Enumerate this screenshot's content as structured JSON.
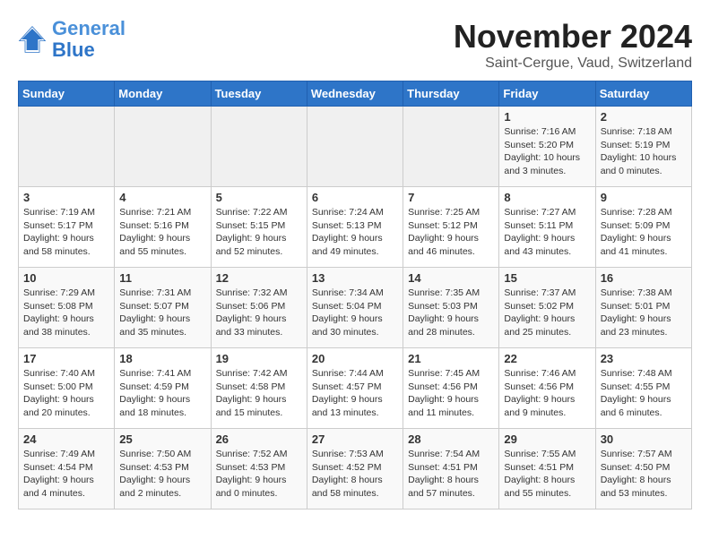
{
  "header": {
    "logo_line1": "General",
    "logo_line2": "Blue",
    "month": "November 2024",
    "location": "Saint-Cergue, Vaud, Switzerland"
  },
  "weekdays": [
    "Sunday",
    "Monday",
    "Tuesday",
    "Wednesday",
    "Thursday",
    "Friday",
    "Saturday"
  ],
  "weeks": [
    [
      {
        "day": "",
        "info": ""
      },
      {
        "day": "",
        "info": ""
      },
      {
        "day": "",
        "info": ""
      },
      {
        "day": "",
        "info": ""
      },
      {
        "day": "",
        "info": ""
      },
      {
        "day": "1",
        "info": "Sunrise: 7:16 AM\nSunset: 5:20 PM\nDaylight: 10 hours\nand 3 minutes."
      },
      {
        "day": "2",
        "info": "Sunrise: 7:18 AM\nSunset: 5:19 PM\nDaylight: 10 hours\nand 0 minutes."
      }
    ],
    [
      {
        "day": "3",
        "info": "Sunrise: 7:19 AM\nSunset: 5:17 PM\nDaylight: 9 hours\nand 58 minutes."
      },
      {
        "day": "4",
        "info": "Sunrise: 7:21 AM\nSunset: 5:16 PM\nDaylight: 9 hours\nand 55 minutes."
      },
      {
        "day": "5",
        "info": "Sunrise: 7:22 AM\nSunset: 5:15 PM\nDaylight: 9 hours\nand 52 minutes."
      },
      {
        "day": "6",
        "info": "Sunrise: 7:24 AM\nSunset: 5:13 PM\nDaylight: 9 hours\nand 49 minutes."
      },
      {
        "day": "7",
        "info": "Sunrise: 7:25 AM\nSunset: 5:12 PM\nDaylight: 9 hours\nand 46 minutes."
      },
      {
        "day": "8",
        "info": "Sunrise: 7:27 AM\nSunset: 5:11 PM\nDaylight: 9 hours\nand 43 minutes."
      },
      {
        "day": "9",
        "info": "Sunrise: 7:28 AM\nSunset: 5:09 PM\nDaylight: 9 hours\nand 41 minutes."
      }
    ],
    [
      {
        "day": "10",
        "info": "Sunrise: 7:29 AM\nSunset: 5:08 PM\nDaylight: 9 hours\nand 38 minutes."
      },
      {
        "day": "11",
        "info": "Sunrise: 7:31 AM\nSunset: 5:07 PM\nDaylight: 9 hours\nand 35 minutes."
      },
      {
        "day": "12",
        "info": "Sunrise: 7:32 AM\nSunset: 5:06 PM\nDaylight: 9 hours\nand 33 minutes."
      },
      {
        "day": "13",
        "info": "Sunrise: 7:34 AM\nSunset: 5:04 PM\nDaylight: 9 hours\nand 30 minutes."
      },
      {
        "day": "14",
        "info": "Sunrise: 7:35 AM\nSunset: 5:03 PM\nDaylight: 9 hours\nand 28 minutes."
      },
      {
        "day": "15",
        "info": "Sunrise: 7:37 AM\nSunset: 5:02 PM\nDaylight: 9 hours\nand 25 minutes."
      },
      {
        "day": "16",
        "info": "Sunrise: 7:38 AM\nSunset: 5:01 PM\nDaylight: 9 hours\nand 23 minutes."
      }
    ],
    [
      {
        "day": "17",
        "info": "Sunrise: 7:40 AM\nSunset: 5:00 PM\nDaylight: 9 hours\nand 20 minutes."
      },
      {
        "day": "18",
        "info": "Sunrise: 7:41 AM\nSunset: 4:59 PM\nDaylight: 9 hours\nand 18 minutes."
      },
      {
        "day": "19",
        "info": "Sunrise: 7:42 AM\nSunset: 4:58 PM\nDaylight: 9 hours\nand 15 minutes."
      },
      {
        "day": "20",
        "info": "Sunrise: 7:44 AM\nSunset: 4:57 PM\nDaylight: 9 hours\nand 13 minutes."
      },
      {
        "day": "21",
        "info": "Sunrise: 7:45 AM\nSunset: 4:56 PM\nDaylight: 9 hours\nand 11 minutes."
      },
      {
        "day": "22",
        "info": "Sunrise: 7:46 AM\nSunset: 4:56 PM\nDaylight: 9 hours\nand 9 minutes."
      },
      {
        "day": "23",
        "info": "Sunrise: 7:48 AM\nSunset: 4:55 PM\nDaylight: 9 hours\nand 6 minutes."
      }
    ],
    [
      {
        "day": "24",
        "info": "Sunrise: 7:49 AM\nSunset: 4:54 PM\nDaylight: 9 hours\nand 4 minutes."
      },
      {
        "day": "25",
        "info": "Sunrise: 7:50 AM\nSunset: 4:53 PM\nDaylight: 9 hours\nand 2 minutes."
      },
      {
        "day": "26",
        "info": "Sunrise: 7:52 AM\nSunset: 4:53 PM\nDaylight: 9 hours\nand 0 minutes."
      },
      {
        "day": "27",
        "info": "Sunrise: 7:53 AM\nSunset: 4:52 PM\nDaylight: 8 hours\nand 58 minutes."
      },
      {
        "day": "28",
        "info": "Sunrise: 7:54 AM\nSunset: 4:51 PM\nDaylight: 8 hours\nand 57 minutes."
      },
      {
        "day": "29",
        "info": "Sunrise: 7:55 AM\nSunset: 4:51 PM\nDaylight: 8 hours\nand 55 minutes."
      },
      {
        "day": "30",
        "info": "Sunrise: 7:57 AM\nSunset: 4:50 PM\nDaylight: 8 hours\nand 53 minutes."
      }
    ]
  ]
}
